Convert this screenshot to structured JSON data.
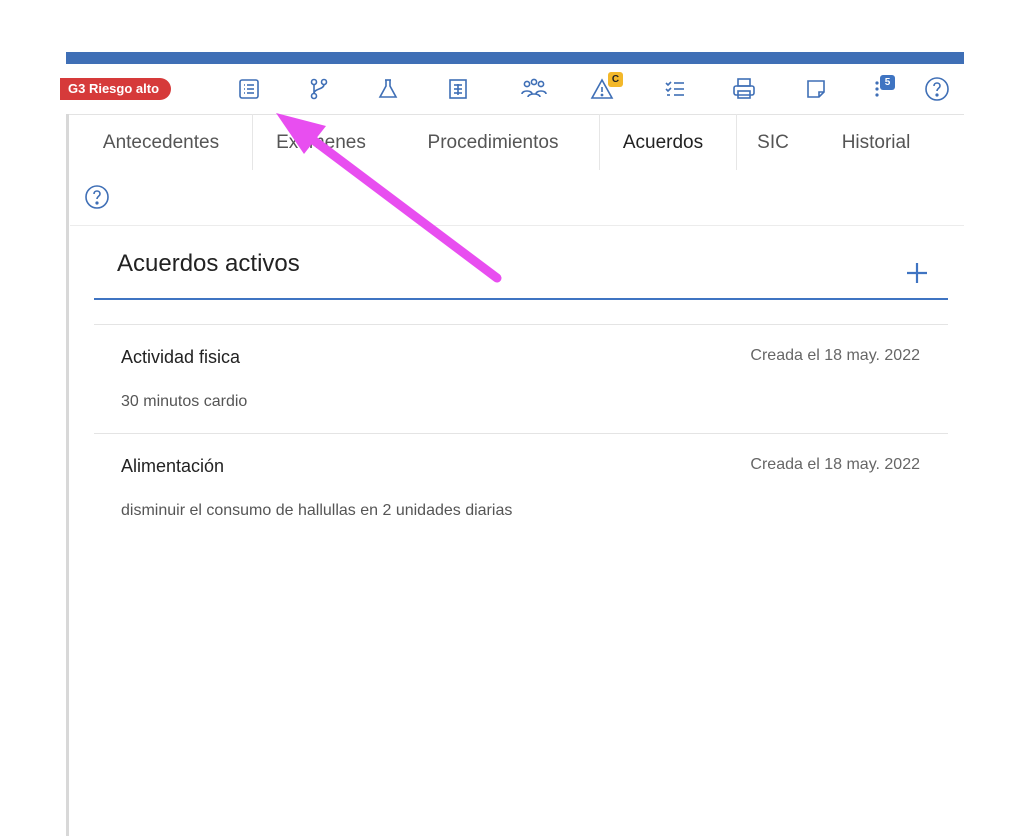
{
  "risk_badge": {
    "label": "G3 Riesgo alto",
    "color": "#d63a3a"
  },
  "colors": {
    "accent": "#3f74c2",
    "icon": "#3f6fb6",
    "annotation_arrow": "#e84ef0",
    "badge_warning": "#f3b82a"
  },
  "toolbar": {
    "icons": [
      {
        "name": "list-icon"
      },
      {
        "name": "branch-icon"
      },
      {
        "name": "flask-icon"
      },
      {
        "name": "document-icon"
      },
      {
        "name": "group-icon"
      },
      {
        "name": "warning-icon",
        "badge": "C"
      },
      {
        "name": "checklist-icon"
      },
      {
        "name": "printer-icon"
      },
      {
        "name": "note-icon"
      },
      {
        "name": "more-icon",
        "badge": "5"
      },
      {
        "name": "help-icon"
      }
    ]
  },
  "tabs": [
    {
      "label": "Antecedentes",
      "active": false
    },
    {
      "label": "Exámenes",
      "active": false
    },
    {
      "label": "Procedimientos",
      "active": false
    },
    {
      "label": "Acuerdos",
      "active": true
    },
    {
      "label": "SIC",
      "active": false
    },
    {
      "label": "Historial",
      "active": false
    }
  ],
  "section": {
    "title": "Acuerdos activos",
    "add_icon": "plus-icon"
  },
  "agreements": [
    {
      "title": "Actividad fisica",
      "date": "Creada el 18 may. 2022",
      "description": "30 minutos cardio"
    },
    {
      "title": "Alimentación",
      "date": "Creada el 18 may. 2022",
      "description": "disminuir el consumo de hallullas en 2 unidades diarias"
    }
  ]
}
